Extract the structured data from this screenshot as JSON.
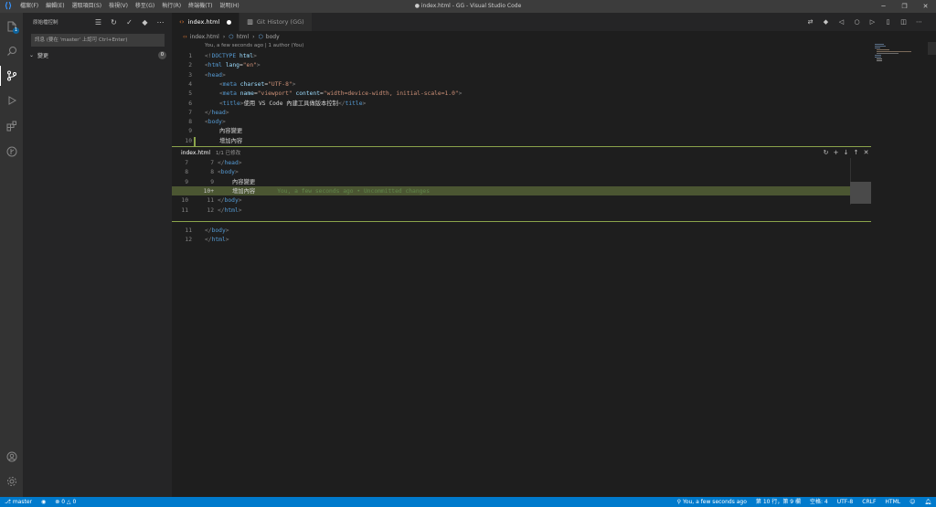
{
  "window": {
    "title": "● index.html - GG - Visual Studio Code",
    "menu": [
      "檔案(F)",
      "編輯(E)",
      "選取項目(S)",
      "檢視(V)",
      "移至(G)",
      "執行(R)",
      "終端機(T)",
      "說明(H)"
    ],
    "controls": [
      "─",
      "❐",
      "✕"
    ]
  },
  "activity_bar": {
    "explorer_badge": "1"
  },
  "sidebar": {
    "title": "原始檔控制",
    "commit_placeholder": "訊息 (要在 'master' 上認可 Ctrl+Enter)",
    "changes_label": "變更",
    "changes_count": "0"
  },
  "tabs": [
    {
      "label": "index.html",
      "dirty": true
    },
    {
      "label": "Git History (GG)",
      "dirty": false
    }
  ],
  "breadcrumb": [
    "index.html",
    "html",
    "body"
  ],
  "blame_header": "You, a few seconds ago | 1 author (You)",
  "editor_lines": [
    {
      "n": "1",
      "indent": 0,
      "tokens": [
        [
          "punct",
          "<!"
        ],
        [
          "tag",
          "DOCTYPE"
        ],
        [
          "txt",
          " "
        ],
        [
          "attr",
          "html"
        ],
        [
          "punct",
          ">"
        ]
      ]
    },
    {
      "n": "2",
      "indent": 0,
      "tokens": [
        [
          "punct",
          "<"
        ],
        [
          "tag",
          "html"
        ],
        [
          "txt",
          " "
        ],
        [
          "attr",
          "lang"
        ],
        [
          "txt",
          "="
        ],
        [
          "str",
          "\"en\""
        ],
        [
          "punct",
          ">"
        ]
      ]
    },
    {
      "n": "3",
      "indent": 0,
      "tokens": [
        [
          "punct",
          "<"
        ],
        [
          "tag",
          "head"
        ],
        [
          "punct",
          ">"
        ]
      ]
    },
    {
      "n": "4",
      "indent": 1,
      "tokens": [
        [
          "punct",
          "<"
        ],
        [
          "tag",
          "meta"
        ],
        [
          "txt",
          " "
        ],
        [
          "attr",
          "charset"
        ],
        [
          "txt",
          "="
        ],
        [
          "str",
          "\"UTF-8\""
        ],
        [
          "punct",
          ">"
        ]
      ]
    },
    {
      "n": "5",
      "indent": 1,
      "tokens": [
        [
          "punct",
          "<"
        ],
        [
          "tag",
          "meta"
        ],
        [
          "txt",
          " "
        ],
        [
          "attr",
          "name"
        ],
        [
          "txt",
          "="
        ],
        [
          "str",
          "\"viewport\""
        ],
        [
          "txt",
          " "
        ],
        [
          "attr",
          "content"
        ],
        [
          "txt",
          "="
        ],
        [
          "str",
          "\"width=device-width, initial-scale=1.0\""
        ],
        [
          "punct",
          ">"
        ]
      ]
    },
    {
      "n": "6",
      "indent": 1,
      "tokens": [
        [
          "punct",
          "<"
        ],
        [
          "tag",
          "title"
        ],
        [
          "punct",
          ">"
        ],
        [
          "txt",
          "使用 VS Code 內建工具做版本控制"
        ],
        [
          "punct",
          "</"
        ],
        [
          "tag",
          "title"
        ],
        [
          "punct",
          ">"
        ]
      ]
    },
    {
      "n": "7",
      "indent": 0,
      "tokens": [
        [
          "punct",
          "</"
        ],
        [
          "tag",
          "head"
        ],
        [
          "punct",
          ">"
        ]
      ]
    },
    {
      "n": "8",
      "indent": 0,
      "tokens": [
        [
          "punct",
          "<"
        ],
        [
          "tag",
          "body"
        ],
        [
          "punct",
          ">"
        ]
      ]
    },
    {
      "n": "9",
      "indent": 1,
      "tokens": [
        [
          "txt",
          "內容變更"
        ]
      ]
    },
    {
      "n": "10",
      "indent": 1,
      "tokens": [
        [
          "txt",
          "增加內容"
        ]
      ]
    }
  ],
  "peek": {
    "file": "index.html",
    "info": "1/1 已修改",
    "actions": [
      "↻",
      "+",
      "↓",
      "↑",
      "✕"
    ],
    "lines": [
      {
        "old": "7",
        "new": "7",
        "indent": 0,
        "tokens": [
          [
            "punct",
            "</"
          ],
          [
            "tag",
            "head"
          ],
          [
            "punct",
            ">"
          ]
        ]
      },
      {
        "old": "8",
        "new": "8",
        "indent": 0,
        "tokens": [
          [
            "punct",
            "<"
          ],
          [
            "tag",
            "body"
          ],
          [
            "punct",
            ">"
          ]
        ]
      },
      {
        "old": "9",
        "new": "9",
        "indent": 1,
        "tokens": [
          [
            "txt",
            "內容變更"
          ]
        ]
      },
      {
        "old": "",
        "new": "10+",
        "indent": 1,
        "tokens": [
          [
            "txt",
            "增加內容"
          ]
        ],
        "added": true
      },
      {
        "old": "10",
        "new": "11",
        "indent": 0,
        "tokens": [
          [
            "punct",
            "</"
          ],
          [
            "tag",
            "body"
          ],
          [
            "punct",
            ">"
          ]
        ]
      },
      {
        "old": "11",
        "new": "12",
        "indent": 0,
        "tokens": [
          [
            "punct",
            "</"
          ],
          [
            "tag",
            "html"
          ],
          [
            "punct",
            ">"
          ]
        ]
      }
    ],
    "inline_blame": "You, a few seconds ago • Uncommitted changes"
  },
  "after_lines": [
    {
      "n": "11",
      "indent": 0,
      "tokens": [
        [
          "punct",
          "</"
        ],
        [
          "tag",
          "body"
        ],
        [
          "punct",
          ">"
        ]
      ]
    },
    {
      "n": "12",
      "indent": 0,
      "tokens": [
        [
          "punct",
          "</"
        ],
        [
          "tag",
          "html"
        ],
        [
          "punct",
          ">"
        ]
      ]
    }
  ],
  "statusbar": {
    "branch": "master",
    "errors": "0",
    "warnings": "0",
    "blame": "You, a few seconds ago",
    "position": "第 10 行，第 9 欄",
    "spaces": "空格: 4",
    "encoding": "UTF-8",
    "eol": "CRLF",
    "language": "HTML"
  },
  "colors": {
    "accent": "#007acc",
    "added": "#8ba44b"
  }
}
